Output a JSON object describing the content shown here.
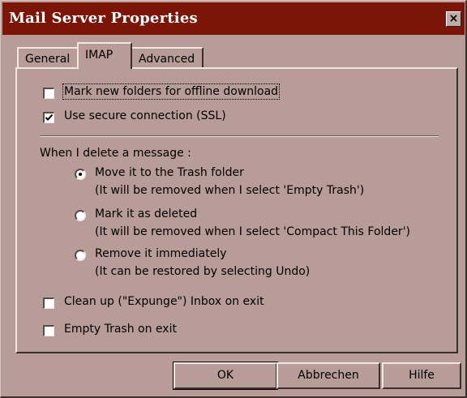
{
  "window": {
    "title": "Mail Server Properties",
    "close_glyph": "×"
  },
  "tabs": [
    {
      "label": "General",
      "active": false
    },
    {
      "label": "IMAP",
      "active": true
    },
    {
      "label": "Advanced",
      "active": false
    }
  ],
  "imap": {
    "offline_download": {
      "label": "Mark new folders for offline download",
      "checked": false
    },
    "secure_connection": {
      "label": "Use secure connection (SSL)",
      "checked": true
    },
    "delete_heading": "When I delete a message :",
    "delete_options": [
      {
        "label": "Move it to the Trash folder",
        "note": "(It will be removed when I select 'Empty Trash')",
        "selected": true
      },
      {
        "label": "Mark it as deleted",
        "note": "(It will be removed when I select 'Compact This Folder')",
        "selected": false
      },
      {
        "label": "Remove it immediately",
        "note": "(It can be restored by selecting Undo)",
        "selected": false
      }
    ],
    "cleanup_inbox": {
      "label": "Clean up (\"Expunge\") Inbox on exit",
      "checked": false
    },
    "empty_trash": {
      "label": "Empty Trash on exit",
      "checked": false
    }
  },
  "buttons": {
    "ok": "OK",
    "cancel": "Abbrechen",
    "help": "Hilfe"
  },
  "colors": {
    "title_bar": "#7a1508",
    "face": "#b79c97"
  }
}
